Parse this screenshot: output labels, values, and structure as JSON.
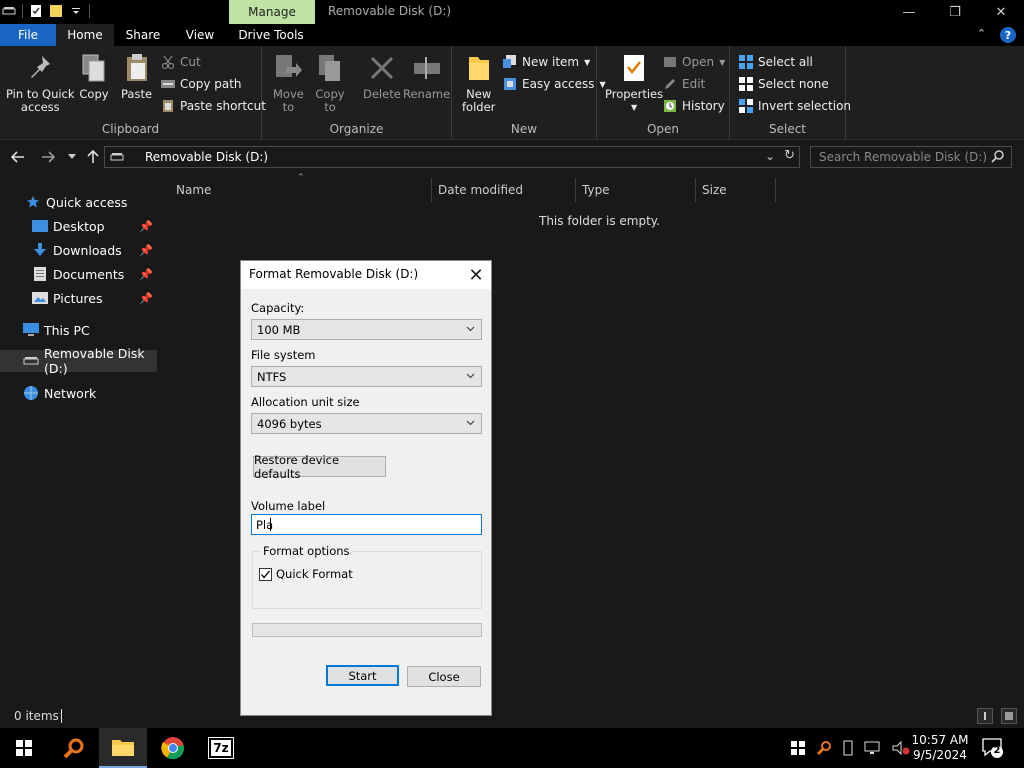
{
  "titlebar": {
    "manage_tab": "Manage",
    "title": "Removable Disk (D:)",
    "minimize": "—",
    "restore": "❐",
    "close": "✕"
  },
  "tabs": {
    "file": "File",
    "home": "Home",
    "share": "Share",
    "view": "View",
    "drive_tools": "Drive Tools",
    "collapse": "⌃",
    "help": "?"
  },
  "ribbon": {
    "clipboard": {
      "label": "Clipboard",
      "pin_line1": "Pin to Quick",
      "pin_line2": "access",
      "copy": "Copy",
      "paste": "Paste",
      "cut": "Cut",
      "copy_path": "Copy path",
      "paste_shortcut": "Paste shortcut"
    },
    "organize": {
      "label": "Organize",
      "move_line1": "Move",
      "move_line2": "to",
      "copy_line1": "Copy",
      "copy_line2": "to",
      "delete": "Delete",
      "rename": "Rename"
    },
    "new": {
      "label": "New",
      "new_folder_line1": "New",
      "new_folder_line2": "folder",
      "new_item": "New item",
      "easy_access": "Easy access"
    },
    "open": {
      "label": "Open",
      "properties": "Properties",
      "open": "Open",
      "edit": "Edit",
      "history": "History"
    },
    "select": {
      "label": "Select",
      "select_all": "Select all",
      "select_none": "Select none",
      "invert": "Invert selection"
    }
  },
  "address": {
    "path": "Removable Disk (D:)",
    "search_placeholder": "Search Removable Disk (D:)"
  },
  "nav": {
    "quick_access": "Quick access",
    "desktop": "Desktop",
    "downloads": "Downloads",
    "documents": "Documents",
    "pictures": "Pictures",
    "this_pc": "This PC",
    "removable": "Removable Disk (D:)",
    "network": "Network"
  },
  "columns": {
    "name": "Name",
    "date": "Date modified",
    "type": "Type",
    "size": "Size"
  },
  "content": {
    "empty": "This folder is empty."
  },
  "status": {
    "items": "0 items"
  },
  "dialog": {
    "title": "Format Removable Disk (D:)",
    "capacity_label": "Capacity:",
    "capacity_value": "100 MB",
    "fs_label": "File system",
    "fs_value": "NTFS",
    "alloc_label": "Allocation unit size",
    "alloc_value": "4096 bytes",
    "restore_btn": "Restore device defaults",
    "volume_label": "Volume label",
    "volume_value": "Pla",
    "format_options": "Format options",
    "quick_format": "Quick Format",
    "quick_format_checked": true,
    "progress": 0,
    "start": "Start",
    "close": "Close"
  },
  "taskbar": {
    "time": "10:57 AM",
    "date": "9/5/2024",
    "notifications": "2",
    "sevenzip": "7z"
  },
  "colors": {
    "accent": "#1a64c4",
    "manage": "#bfe3a3",
    "focus": "#0078d7"
  }
}
